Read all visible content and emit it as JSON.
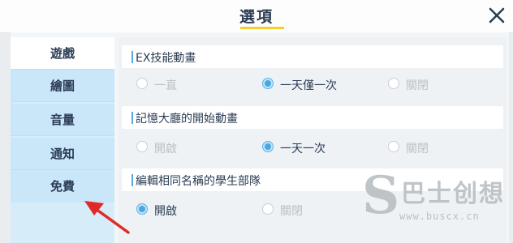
{
  "header": {
    "title": "選項",
    "close_icon": "close-icon"
  },
  "sidebar": {
    "items": [
      {
        "label": "遊戲",
        "active": true
      },
      {
        "label": "繪圖",
        "active": false
      },
      {
        "label": "音量",
        "active": false
      },
      {
        "label": "通知",
        "active": false
      },
      {
        "label": "免費",
        "active": false
      }
    ]
  },
  "settings": [
    {
      "title": "EX技能動畫",
      "options": [
        "一直",
        "一天僅一次",
        "關閉"
      ],
      "selected": 1
    },
    {
      "title": "記憶大廳的開始動畫",
      "options": [
        "開啟",
        "一天一次",
        "關閉"
      ],
      "selected": 1
    },
    {
      "title": "編輯相同名稱的學生部隊",
      "options": [
        "開啟",
        "關閉"
      ],
      "selected": 0
    }
  ],
  "watermark": {
    "letter": "S",
    "text": "巴士创想",
    "url": "www.buscx.cn"
  },
  "colors": {
    "accent": "#4aa7e2",
    "title_underline": "#f4d02a",
    "arrow": "#e02a2a"
  }
}
